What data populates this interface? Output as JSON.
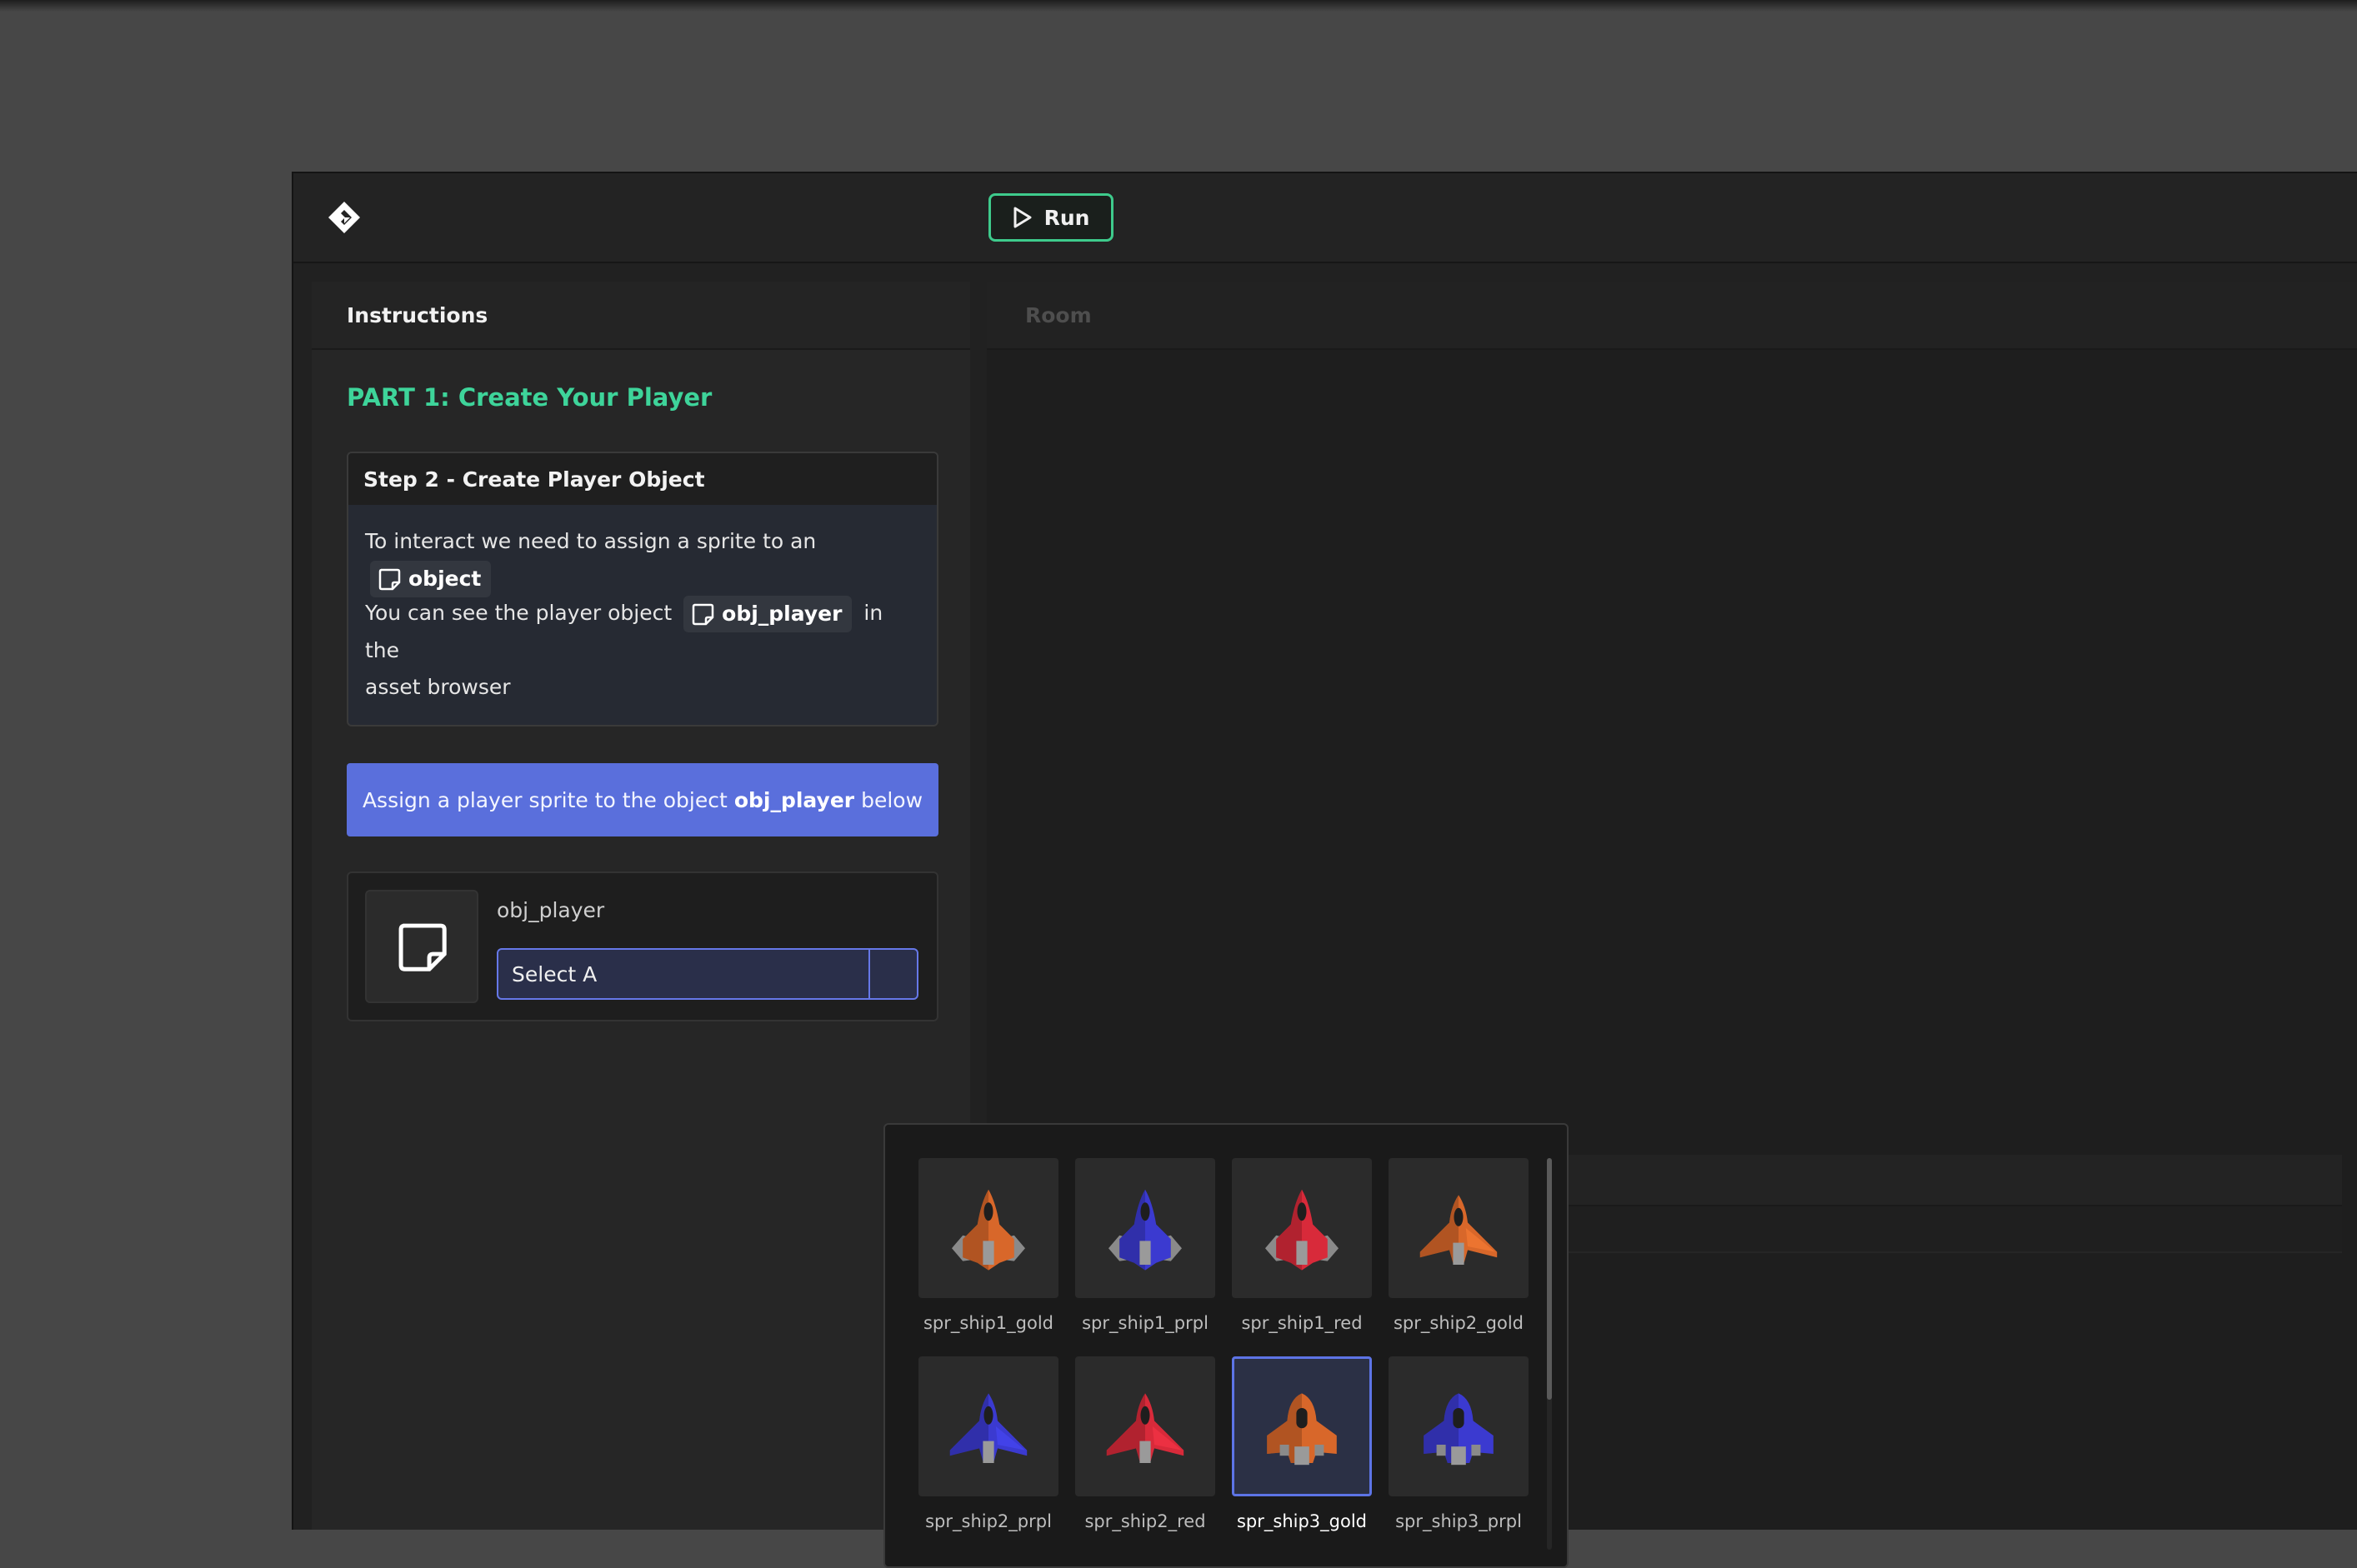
{
  "toolbar": {
    "run_label": "Run"
  },
  "instructions": {
    "header": "Instructions",
    "part_title": "PART 1: Create Your Player",
    "step": {
      "title": "Step 2 - Create Player Object",
      "line1_text": "To interact we need to assign a sprite to an",
      "line1_chip": "object",
      "line2_text": "You can see the player object",
      "line2_chip": "obj_player",
      "line2_after": "in the",
      "line3_text": "asset browser"
    },
    "assign": {
      "prefix": "Assign a player sprite to the object",
      "object": "obj_player",
      "suffix": "below"
    },
    "object_card": {
      "name": "obj_player",
      "select_value": "Select A"
    }
  },
  "room": {
    "header": "Room"
  },
  "sprite_picker": {
    "selected_index": 6,
    "sprites": [
      {
        "label": "spr_ship1_gold",
        "variant": "ship1",
        "color": "#d8672a"
      },
      {
        "label": "spr_ship1_prpl",
        "variant": "ship1",
        "color": "#3b3ad0"
      },
      {
        "label": "spr_ship1_red",
        "variant": "ship1",
        "color": "#d82a3a"
      },
      {
        "label": "spr_ship2_gold",
        "variant": "ship2",
        "color": "#d8672a"
      },
      {
        "label": "spr_ship2_prpl",
        "variant": "ship2",
        "color": "#3b3ad0"
      },
      {
        "label": "spr_ship2_red",
        "variant": "ship2",
        "color": "#d82a3a"
      },
      {
        "label": "spr_ship3_gold",
        "variant": "ship3",
        "color": "#d8672a"
      },
      {
        "label": "spr_ship3_prpl",
        "variant": "ship3",
        "color": "#3b3ad0"
      }
    ]
  },
  "colors": {
    "accent_green": "#3ecb8c",
    "accent_blue": "#5a6fdc",
    "background": "#212121"
  }
}
